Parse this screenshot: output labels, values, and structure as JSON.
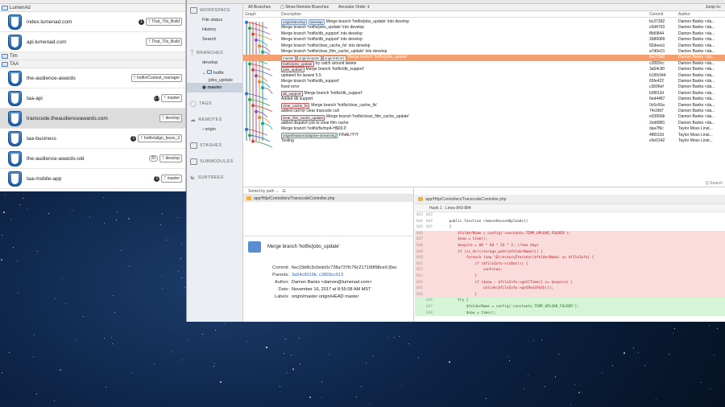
{
  "repos": {
    "groups": [
      {
        "name": "LumenAd",
        "repos": [
          {
            "name": "index.lumenad.com",
            "badges": [
              "That_70s_Build"
            ],
            "count": "1",
            "sel": false
          },
          {
            "name": "api.lumenad.com",
            "badges": [
              "That_70s_Build"
            ],
            "count": "",
            "sel": false
          }
        ]
      },
      {
        "name": "Tim",
        "repos": []
      },
      {
        "name": "TAA",
        "repos": [
          {
            "name": "the-audience-awards",
            "badges": [
              "hotfix/Contest_manager"
            ],
            "count": "",
            "sel": false
          },
          {
            "name": "taa-api",
            "badges": [
              "master"
            ],
            "count": "1 1",
            "sel": false
          },
          {
            "name": "transcode.theaudienceawards.com",
            "badges": [
              "develop"
            ],
            "count": "",
            "sel": true
          },
          {
            "name": "taa-business",
            "badges": [
              "hotfix/align_faces_3"
            ],
            "count": "1",
            "sel": false
          },
          {
            "name": "the-audience-awards-old",
            "badges": [
              "develop"
            ],
            "count": "20",
            "sel": false
          },
          {
            "name": "taa-mobile-app",
            "badges": [
              "master"
            ],
            "count": "2",
            "sel": false
          }
        ]
      }
    ]
  },
  "sidebar": {
    "workspace": "WORKSPACE",
    "file_status": "File status",
    "history": "History",
    "search": "Search",
    "branches": "BRANCHES",
    "develop": "develop",
    "hotfix": "hotfix",
    "jobs_update": "jobs_update",
    "master": "master",
    "tags": "TAGS",
    "remotes": "REMOTES",
    "origin": "origin",
    "stashes": "STASHES",
    "submodules": "SUBMODULES",
    "subtrees": "SUBTREES"
  },
  "filter": {
    "all_branches": "All Branches",
    "show_remote": "Show Remote Branches",
    "ancestor": "Ancestor Order",
    "jump": "Jump to:"
  },
  "columns": {
    "graph": "Graph",
    "description": "Description",
    "commit": "Commit",
    "author": "Author"
  },
  "log": [
    {
      "refs": [
        [
          "origin/develop",
          ""
        ],
        [
          "develop",
          ""
        ]
      ],
      "text": "Merge branch 'hotfix/jobs_update' into develop",
      "commit": "bc37392",
      "author": "Damon Banks <da...",
      "sel": false
    },
    {
      "refs": [],
      "text": "Merge branch 'hotfix/jobs_update' into develop",
      "commit": "c0d4703",
      "author": "Damon Banks <da...",
      "sel": false
    },
    {
      "refs": [],
      "text": "Merge branch 'hotfix/db_support' into develop",
      "commit": "f8d0844",
      "author": "Damon Banks <da...",
      "sel": false
    },
    {
      "refs": [],
      "text": "Merge branch 'hotfix/db_support' into develop",
      "commit": "2b86089",
      "author": "Damon Banks <da...",
      "sel": false
    },
    {
      "refs": [],
      "text": "Merge branch 'hotfix/clear_cache_fix' into develop",
      "commit": "82deea1",
      "author": "Damon Banks <da...",
      "sel": false
    },
    {
      "refs": [],
      "text": "Merge branch 'hotfix/clear_film_cache_update' into develop",
      "commit": "a7d0e21",
      "author": "Damon Banks <da...",
      "sel": false
    },
    {
      "refs": [
        [
          "master",
          ""
        ],
        [
          "origin/master",
          ""
        ],
        [
          "origin/HEAD",
          ""
        ]
      ],
      "text": "Merge branch 'hotfix/jobs_update'",
      "commit": "6ec15b8",
      "author": "Damon Banks <da...",
      "sel": true
    },
    {
      "refs": [
        [
          "hotfix/jobs_update",
          "red"
        ]
      ],
      "text": "try catch around delete",
      "commit": "c2893cc",
      "author": "Damon Banks <da...",
      "sel": false
    },
    {
      "refs": [
        [
          "jobs_update",
          "red"
        ]
      ],
      "text": "Merge branch 'hotfix/db_support'",
      "commit": "3a54c90",
      "author": "Damon Banks <da...",
      "sel": false
    },
    {
      "refs": [],
      "text": "updated for laravel 5.5",
      "commit": "b19fc944",
      "author": "Damon Banks <da...",
      "sel": false
    },
    {
      "refs": [],
      "text": "Merge branch 'hotfix/db_support'",
      "commit": "65fe422",
      "author": "Damon Banks <da...",
      "sel": false
    },
    {
      "refs": [],
      "text": "fixed error",
      "commit": "c3696ef",
      "author": "Damon Banks <da...",
      "sel": false
    },
    {
      "refs": [
        [
          "db_support",
          "red"
        ]
      ],
      "text": "Merge branch 'hotfix/db_support'",
      "commit": "b3f812d",
      "author": "Damon Banks <da...",
      "sel": false
    },
    {
      "refs": [],
      "text": "Added db support",
      "commit": "6ed4487",
      "author": "Damon Banks <da...",
      "sel": false
    },
    {
      "refs": [
        [
          "clear_cache_fix",
          "red"
        ]
      ],
      "text": "Merge branch 'hotfix/clear_cache_fix'",
      "commit": "0c6c66a",
      "author": "Damon Banks <da...",
      "sel": false
    },
    {
      "refs": [],
      "text": "added call for clear trascode cull",
      "commit": "74c0fd7",
      "author": "Damon Banks <da...",
      "sel": false
    },
    {
      "refs": [
        [
          "clear_film_cache_update",
          "red"
        ]
      ],
      "text": "Merge branch 'hotfix/clear_film_cache_update'",
      "commit": "e03566b",
      "author": "Damon Banks <da...",
      "sel": false
    },
    {
      "refs": [],
      "text": "added dispatch job to clear film cache",
      "commit": "2ed6881",
      "author": "Damon Banks <da...",
      "sel": false
    },
    {
      "refs": [],
      "text": "Merge branch 'hotfix/fix/mp4-H$03.0'",
      "commit": "daa7f6c",
      "author": "Taylor Moss Linst...",
      "sel": false
    },
    {
      "refs": [
        [
          "origin/feature/adaptive-streaming",
          "grn"
        ]
      ],
      "text": "FINAL!!!!!Y",
      "commit": "4f8012d",
      "author": "Taylor Moss Linst...",
      "sel": false
    },
    {
      "refs": [],
      "text": "Testing",
      "commit": "c0e0142",
      "author": "Taylor Moss Linst...",
      "sel": false
    }
  ],
  "files": {
    "sorted": "Sorted by path",
    "file": "app/Http/Controllers/TranscodeController.php"
  },
  "details": {
    "title": "Merge branch 'hotfix/jobs_update'",
    "commit_label": "Commit:",
    "commit": "6ec15b8c3c0edc0c728a737fc76c217100f98ce0 [6ec",
    "parents_label": "Parents:",
    "parents": "3a54c9019b, c2893cc913",
    "author_label": "Author:",
    "author": "Damon Banks <damon@lumenad.com>",
    "date_label": "Date:",
    "date": "November 16, 2017 at 8:55:08 AM MST",
    "labels_label": "Labels:",
    "labels": "origin/master origin/HEAD master"
  },
  "diff": {
    "file": "app/Http/Controllers/TranscodeController.php",
    "hunk": "Hunk 1 : Lines 843-884",
    "search": "Q Search",
    "lines": [
      {
        "a": "843",
        "b": "843",
        "t": "",
        "c": ""
      },
      {
        "a": "844",
        "b": "844",
        "t": "",
        "c": "    public function removeUnusedUploads()"
      },
      {
        "a": "845",
        "b": "845",
        "t": "",
        "c": "    {"
      },
      {
        "a": "846",
        "b": "",
        "t": "del",
        "c": "        $folderName = config('constants.TEMP_UPLOAD_FOLDER');"
      },
      {
        "a": "847",
        "b": "",
        "t": "del",
        "c": "        $now = time();"
      },
      {
        "a": "848",
        "b": "",
        "t": "del",
        "c": "        $expire = 60 * 60 * 24 * 2; //two days"
      },
      {
        "a": "849",
        "b": "",
        "t": "del",
        "c": "        if (is_dir(storage_path($folderName))) {"
      },
      {
        "a": "850",
        "b": "",
        "t": "del",
        "c": "            foreach (new \\DirectoryIterator($folderName) as $fileInfo) {"
      },
      {
        "a": "851",
        "b": "",
        "t": "del",
        "c": "                if ($fileInfo->isDot()) {"
      },
      {
        "a": "852",
        "b": "",
        "t": "del",
        "c": "                    continue;"
      },
      {
        "a": "853",
        "b": "",
        "t": "del",
        "c": "                }"
      },
      {
        "a": "854",
        "b": "",
        "t": "del",
        "c": "                if ($now - $fileInfo->getCTime() >= $expire) {"
      },
      {
        "a": "855",
        "b": "",
        "t": "del",
        "c": "                    unlink($fileInfo->getRealPath());"
      },
      {
        "a": "856",
        "b": "",
        "t": "del",
        "c": "                }"
      },
      {
        "a": "",
        "b": "846",
        "t": "add",
        "c": "        try {"
      },
      {
        "a": "",
        "b": "847",
        "t": "add",
        "c": "            $folderName = config('constants.TEMP_UPLOAD_FOLDER');"
      },
      {
        "a": "",
        "b": "848",
        "t": "add",
        "c": "            $now = time();"
      }
    ]
  }
}
